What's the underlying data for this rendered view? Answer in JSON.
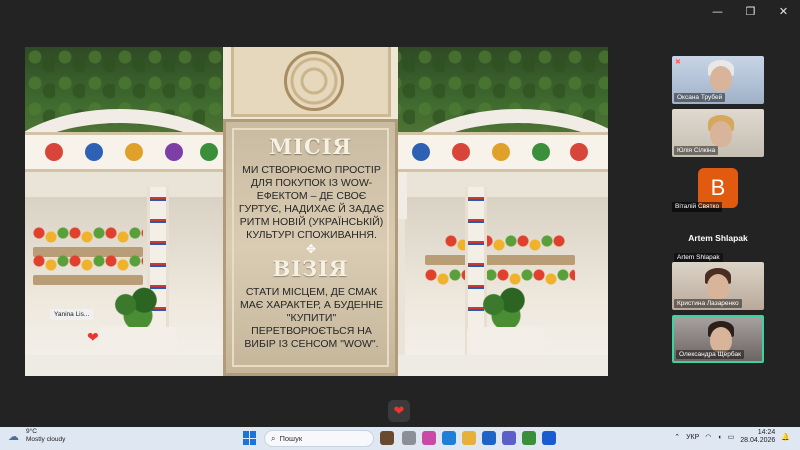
{
  "window": {
    "min_glyph": "—",
    "restore_glyph": "❐",
    "close_glyph": "✕"
  },
  "slide": {
    "mission_title": "МІСІЯ",
    "mission_text": "Ми створюємо простір для покупок із WOW-ефектом – де своє гуртує, надихає й задає ритм новій (українській) культурі споживання.",
    "divider_glyph": "✥",
    "vision_title": "ВІЗІЯ",
    "vision_text": "Стати місцем, де смак має характер, а буденне \"купити\" перетворюється на вибір із сенсом \"WOW\"."
  },
  "presenter_overlay": {
    "label": "Yanina Lis...",
    "heart": "❤"
  },
  "participants": [
    {
      "name": "Оксана Трубей",
      "muted": true
    },
    {
      "name": "Юлія Сілкіна",
      "muted": false
    },
    {
      "name": "Віталій Святко",
      "initial": "B",
      "avatar_color": "#e05a10",
      "muted": true
    },
    {
      "name": "Artem Shlapak",
      "muted": true
    },
    {
      "name": "Кристина Лазаренко",
      "muted": false
    },
    {
      "name": "Олександра Щербак",
      "muted": false,
      "active_border": "#3bd3a0"
    }
  ],
  "speaker_name": "Artem Shlapak",
  "reaction_heart": "❤",
  "taskbar": {
    "weather_temp": "9°C",
    "weather_desc": "Mostly cloudy",
    "search_placeholder": "Пошук",
    "lang": "УКР",
    "time": "14:24",
    "date": "28.04.2026"
  },
  "colors": {
    "taskbar_bg": "#dfe7f2",
    "app_bg": "#232323",
    "accent_green": "#3bd3a0"
  }
}
